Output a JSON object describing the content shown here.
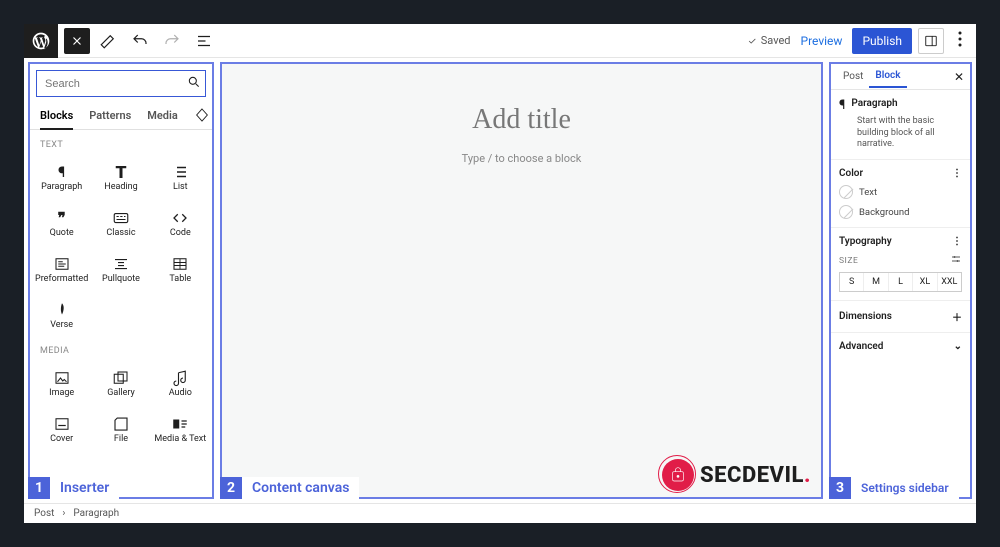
{
  "topbar": {
    "saved": "Saved",
    "preview": "Preview",
    "publish": "Publish"
  },
  "inserter": {
    "search_placeholder": "Search",
    "tabs": [
      "Blocks",
      "Patterns",
      "Media"
    ],
    "sections": {
      "text": {
        "heading": "TEXT",
        "blocks": [
          "Paragraph",
          "Heading",
          "List",
          "Quote",
          "Classic",
          "Code",
          "Preformatted",
          "Pullquote",
          "Table",
          "Verse"
        ]
      },
      "media": {
        "heading": "MEDIA",
        "blocks": [
          "Image",
          "Gallery",
          "Audio",
          "Cover",
          "File",
          "Media & Text"
        ]
      }
    }
  },
  "canvas": {
    "title_placeholder": "Add title",
    "type_placeholder": "Type / to choose a block",
    "brand": "SECDEVIL"
  },
  "settings": {
    "tabs": [
      "Post",
      "Block"
    ],
    "paragraph": {
      "title": "Paragraph",
      "desc": "Start with the basic building block of all narrative."
    },
    "color": {
      "heading": "Color",
      "text": "Text",
      "background": "Background"
    },
    "typography": {
      "heading": "Typography",
      "size_label": "SIZE",
      "sizes": [
        "S",
        "M",
        "L",
        "XL",
        "XXL"
      ]
    },
    "dimensions": "Dimensions",
    "advanced": "Advanced"
  },
  "annotations": {
    "left": "Inserter",
    "center": "Content canvas",
    "right": "Settings sidebar"
  },
  "breadcrumb": {
    "a": "Post",
    "b": "Paragraph"
  }
}
